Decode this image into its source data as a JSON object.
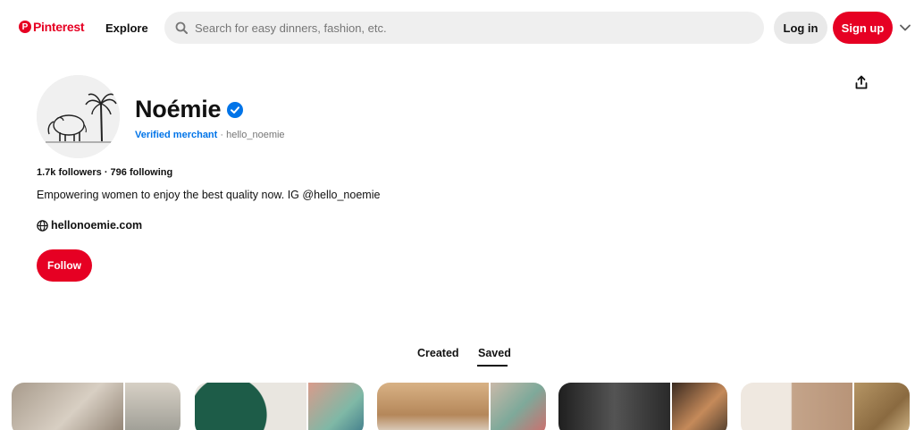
{
  "header": {
    "logo_text": "Pinterest",
    "explore_label": "Explore",
    "search_placeholder": "Search for easy dinners, fashion, etc.",
    "login_label": "Log in",
    "signup_label": "Sign up",
    "brand_color": "#e60023"
  },
  "profile": {
    "name": "Noémie",
    "verified_label": "Verified merchant",
    "separator": " · ",
    "username": "hello_noemie",
    "followers": "1.7k followers",
    "stats_separator": " · ",
    "following": "796 following",
    "bio": "Empowering women to enjoy the best quality now. IG @hello_noemie",
    "website": "hellonoemie.com",
    "follow_label": "Follow",
    "verified_color": "#0074e8"
  },
  "tabs": {
    "created_label": "Created",
    "saved_label": "Saved",
    "active": "Saved"
  },
  "icons": {
    "search": "search-icon",
    "chevron": "chevron-down-icon",
    "share": "share-icon",
    "verified": "verified-badge-icon",
    "globe": "globe-icon"
  },
  "boards": [
    {
      "main_color": "#b9b0a5",
      "side_color": "#cfc6b7"
    },
    {
      "main_color": "#1f5a48",
      "side_color": "#8fb5a6"
    },
    {
      "main_color": "#c49a6c",
      "side_color": "#a8b8ae"
    },
    {
      "main_color": "#2b2b2b",
      "side_color": "#5a4a3c"
    },
    {
      "main_color": "#d9c9b8",
      "side_color": "#a98a5e"
    }
  ]
}
